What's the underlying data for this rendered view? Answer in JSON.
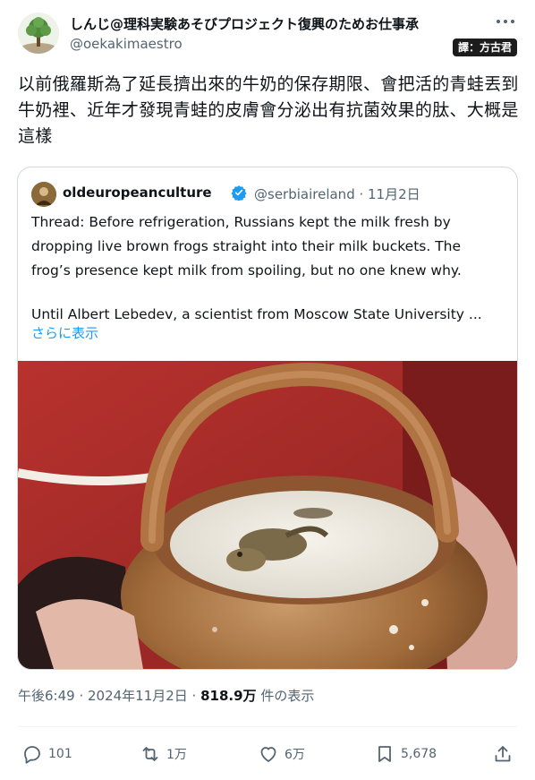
{
  "author": {
    "name": "しんじ@理科実験あそびプロジェクト復興のためお仕事承",
    "handle": "@oekakimaestro",
    "avatar_icon": "tree-avatar-icon"
  },
  "translate_badge": "譯：方古君",
  "tweet_text": "以前俄羅斯為了延長擠出來的牛奶的保存期限、會把活的青蛙丟到牛奶裡、近年才發現青蛙的皮膚會分泌出有抗菌效果的肽、大概是這樣",
  "quote": {
    "name": "oldeuropeanculture",
    "verified": true,
    "handle_date": "@serbiaireland · 11月2日",
    "paragraph1": "Thread: Before refrigeration, Russians kept the milk fresh by dropping live brown frogs straight into their milk buckets. The frog’s presence kept milk from spoiling, but no one knew why.",
    "paragraph2": "Until Albert Lebedev, a scientist from Moscow State University ...",
    "show_more": "さらに表示"
  },
  "meta": {
    "time_date": "午後6:49 · 2024年11月2日 · ",
    "views": "818.9万",
    "views_label": " 件の表示"
  },
  "actions": {
    "reply": "101",
    "retweet": "1万",
    "like": "6万",
    "bookmark": "5,678"
  },
  "colors": {
    "accent": "#1d9bf0",
    "secondary_text": "#536471",
    "primary_text": "#0f1419",
    "border": "#cfd9de"
  }
}
